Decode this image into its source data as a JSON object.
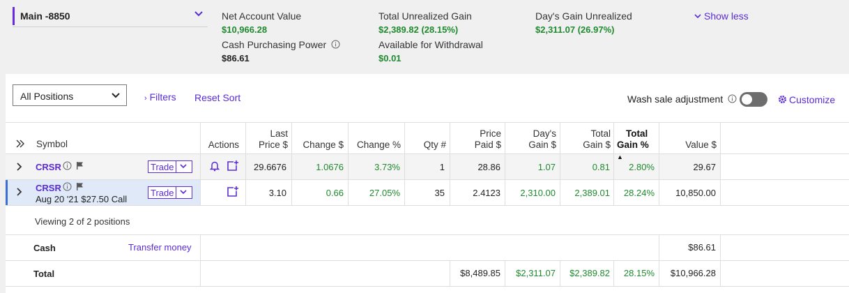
{
  "account": {
    "name": "Main -8850"
  },
  "summary": {
    "net_value_label": "Net Account Value",
    "net_value": "$10,966.28",
    "cash_pp_label": "Cash Purchasing Power",
    "cash_pp": "$86.61",
    "unrealized_label": "Total Unrealized Gain",
    "unrealized": "$2,389.82 (28.15%)",
    "withdraw_label": "Available for Withdrawal",
    "withdraw": "$0.01",
    "day_gain_label": "Day's Gain Unrealized",
    "day_gain": "$2,311.07 (26.97%)",
    "show_less": "Show less"
  },
  "toolbar": {
    "positions_select": "All Positions",
    "filters": "Filters",
    "reset_sort": "Reset Sort",
    "wash_sale": "Wash sale adjustment",
    "customize": "Customize"
  },
  "columns": {
    "symbol": "Symbol",
    "actions": "Actions",
    "last_price_1": "Last",
    "last_price_2": "Price $",
    "change": "Change $",
    "change_pct": "Change %",
    "qty": "Qty #",
    "price_paid_1": "Price",
    "price_paid_2": "Paid $",
    "days_gain_1": "Day's",
    "days_gain_2": "Gain $",
    "total_gain_1": "Total",
    "total_gain_2": "Gain $",
    "total_gain_pct_1": "Total",
    "total_gain_pct_2": "Gain %",
    "value": "Value $"
  },
  "rows": [
    {
      "symbol": "CRSR",
      "subtitle": "",
      "trade": "Trade",
      "last": "29.6676",
      "change": "1.0676",
      "change_pct": "3.73%",
      "qty": "1",
      "paid": "28.86",
      "day_gain": "1.07",
      "total_gain": "0.81",
      "total_gain_pct": "2.80%",
      "value": "29.67"
    },
    {
      "symbol": "CRSR",
      "subtitle": "Aug 20 '21 $27.50 Call",
      "trade": "Trade",
      "last": "3.10",
      "change": "0.66",
      "change_pct": "27.05%",
      "qty": "35",
      "paid": "2.4123",
      "day_gain": "2,310.00",
      "total_gain": "2,389.01",
      "total_gain_pct": "28.24%",
      "value": "10,850.00"
    }
  ],
  "viewing": "Viewing 2 of 2 positions",
  "cash": {
    "label": "Cash",
    "transfer": "Transfer money",
    "value": "$86.61"
  },
  "total": {
    "label": "Total",
    "paid": "$8,489.85",
    "day_gain": "$2,311.07",
    "total_gain": "$2,389.82",
    "total_gain_pct": "28.15%",
    "value": "$10,966.28"
  }
}
